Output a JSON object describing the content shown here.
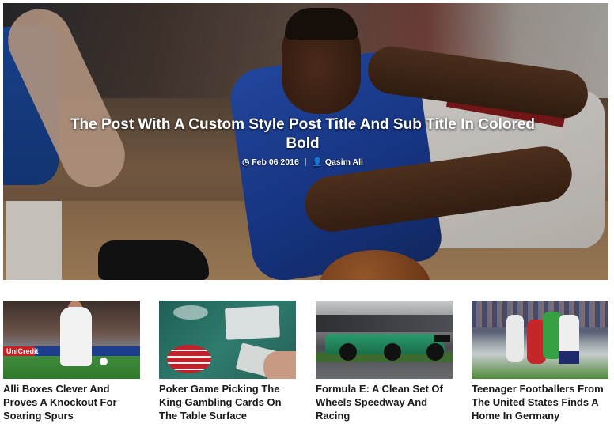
{
  "hero": {
    "title": "The Post With A Custom Style Post Title And Sub Title In Colored Bold",
    "date": "Feb 06 2016",
    "author": "Qasim Ali",
    "date_icon": "clock-icon",
    "author_icon": "user-icon"
  },
  "cards": [
    {
      "title": "Alli Boxes Clever And Proves A Knockout For Soaring Spurs",
      "banner_text": "UniCredit"
    },
    {
      "title": "Poker Game Picking The King Gambling Cards On The Table Surface"
    },
    {
      "title": "Formula E: A Clean Set Of Wheels Speedway And Racing"
    },
    {
      "title": "Teenager Footballers From The United States Finds A Home In Germany"
    }
  ]
}
